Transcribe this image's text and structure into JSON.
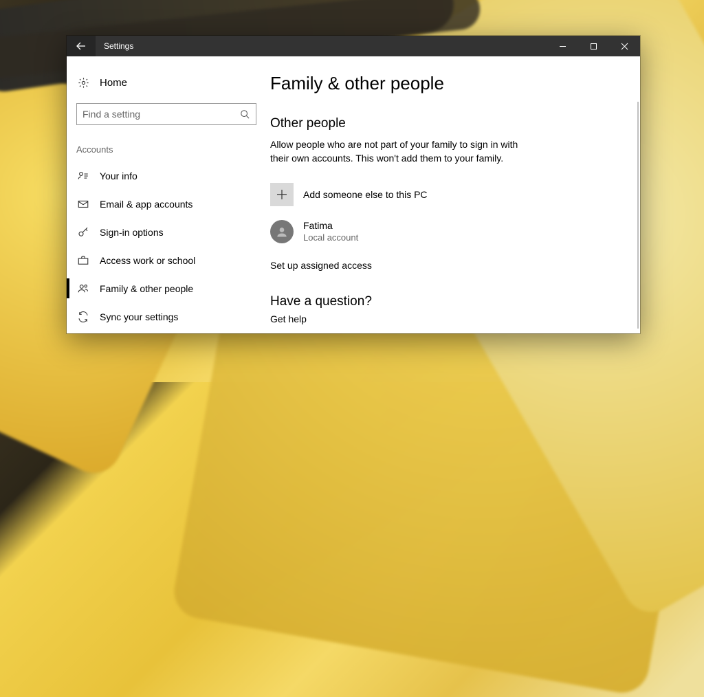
{
  "titlebar": {
    "title": "Settings"
  },
  "sidebar": {
    "home_label": "Home",
    "search_placeholder": "Find a setting",
    "section_label": "Accounts",
    "items": [
      {
        "label": "Your info"
      },
      {
        "label": "Email & app accounts"
      },
      {
        "label": "Sign-in options"
      },
      {
        "label": "Access work or school"
      },
      {
        "label": "Family & other people"
      },
      {
        "label": "Sync your settings"
      }
    ],
    "selected_index": 4
  },
  "main": {
    "heading": "Family & other people",
    "other_people_heading": "Other people",
    "other_people_desc": "Allow people who are not part of your family to sign in with their own accounts. This won't add them to your family.",
    "add_label": "Add someone else to this PC",
    "user": {
      "name": "Fatima",
      "type": "Local account"
    },
    "assigned_access_link": "Set up assigned access",
    "question_heading": "Have a question?",
    "get_help_label": "Get help"
  }
}
